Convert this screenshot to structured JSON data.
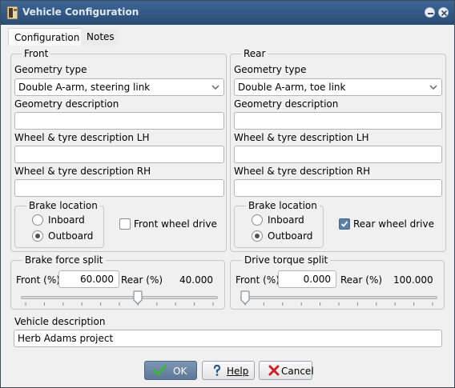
{
  "window": {
    "title": "Vehicle Configuration"
  },
  "tabs": [
    {
      "label": "Configuration",
      "active": true
    },
    {
      "label": "Notes",
      "active": false
    }
  ],
  "front": {
    "legend": "Front",
    "geometry_type_label": "Geometry type",
    "geometry_type_value": "Double A-arm, steering link",
    "geometry_description_label": "Geometry description",
    "geometry_description_value": "",
    "wheel_lh_label": "Wheel & tyre description LH",
    "wheel_lh_value": "",
    "wheel_rh_label": "Wheel & tyre description RH",
    "wheel_rh_value": "",
    "brake_location_legend": "Brake location",
    "brake_options": [
      "Inboard",
      "Outboard"
    ],
    "brake_selected": "Outboard",
    "drive_label": "Front wheel drive",
    "drive_checked": false
  },
  "rear": {
    "legend": "Rear",
    "geometry_type_label": "Geometry type",
    "geometry_type_value": "Double A-arm, toe link",
    "geometry_description_label": "Geometry description",
    "geometry_description_value": "",
    "wheel_lh_label": "Wheel & tyre description LH",
    "wheel_lh_value": "",
    "wheel_rh_label": "Wheel & tyre description RH",
    "wheel_rh_value": "",
    "brake_location_legend": "Brake location",
    "brake_options": [
      "Inboard",
      "Outboard"
    ],
    "brake_selected": "Outboard",
    "drive_label": "Rear wheel drive",
    "drive_checked": true
  },
  "brake_split": {
    "legend": "Brake force split",
    "front_label": "Front (%)",
    "front_value": "60.000",
    "rear_label": "Rear (%)",
    "rear_value": "40.000",
    "slider_fraction": 0.6
  },
  "torque_split": {
    "legend": "Drive torque split",
    "front_label": "Front (%)",
    "front_value": "0.000",
    "rear_label": "Rear (%)",
    "rear_value": "100.000",
    "slider_fraction": 0.0
  },
  "vehicle_description": {
    "label": "Vehicle description",
    "value": "Herb Adams project"
  },
  "buttons": {
    "ok": "OK",
    "help": "Help",
    "cancel": "Cancel"
  },
  "colors": {
    "titlebar": "#2f5582",
    "accent": "#5c7fa8",
    "ok_check": "#3cb43c",
    "cancel_x": "#c8202a"
  }
}
